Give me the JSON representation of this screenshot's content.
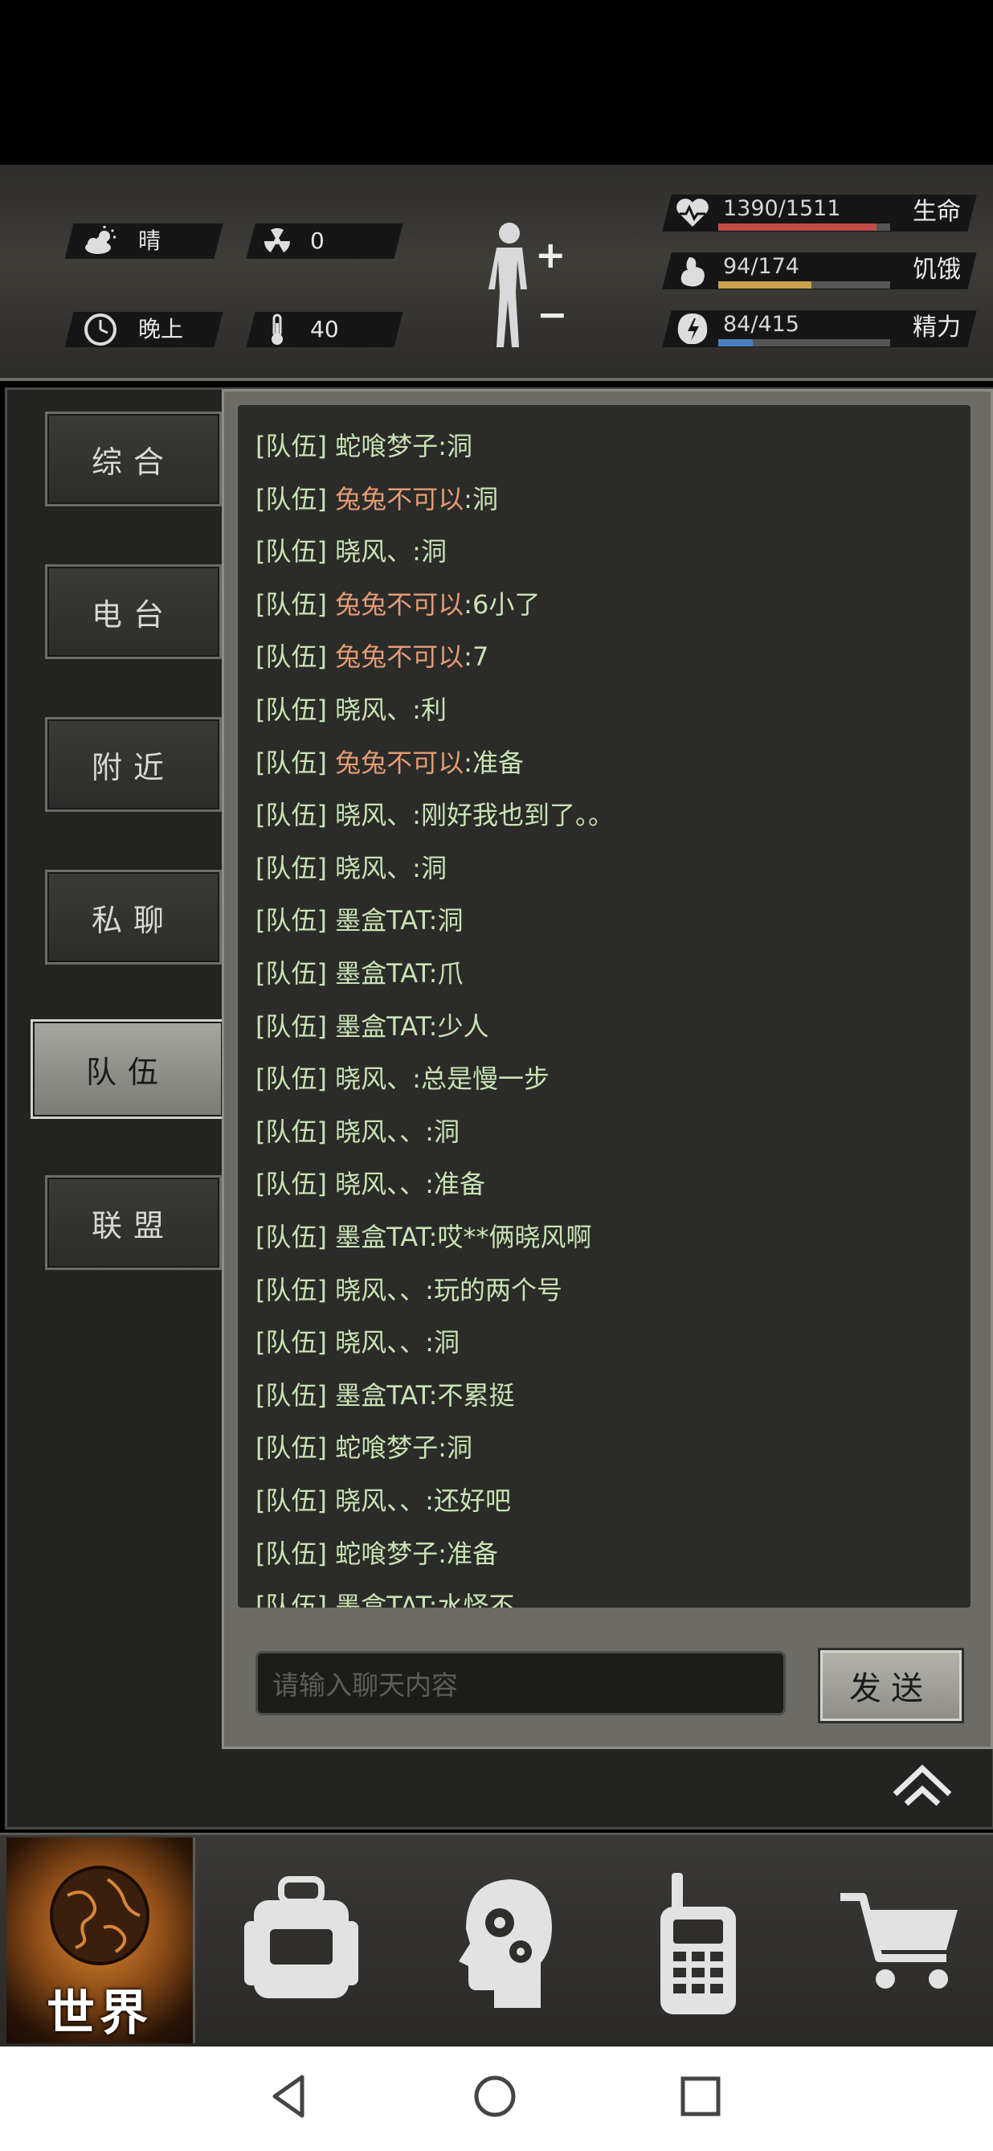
{
  "status": {
    "weather": "晴",
    "radiation": "0",
    "time_of_day": "晚上",
    "temperature": "40"
  },
  "vitals": [
    {
      "label": "生命",
      "value": "1390/1511",
      "current": 1390,
      "max": 1511,
      "color": "#c24d46"
    },
    {
      "label": "饥饿",
      "value": "94/174",
      "current": 94,
      "max": 174,
      "color": "#c9a24b"
    },
    {
      "label": "精力",
      "value": "84/415",
      "current": 84,
      "max": 415,
      "color": "#4a7fc0"
    }
  ],
  "tabs": [
    {
      "label": "综合"
    },
    {
      "label": "电台"
    },
    {
      "label": "附近"
    },
    {
      "label": "私聊"
    },
    {
      "label": "队伍"
    },
    {
      "label": "联盟"
    }
  ],
  "active_tab_index": 4,
  "messages": [
    {
      "channel": "[队伍]",
      "speaker": "蛇喰梦子",
      "text": ":洞",
      "highlight": false
    },
    {
      "channel": "[队伍]",
      "speaker": "兔兔不可以",
      "text": ":洞",
      "highlight": true
    },
    {
      "channel": "[队伍]",
      "speaker": "晓风、",
      "text": ":洞",
      "highlight": false
    },
    {
      "channel": "[队伍]",
      "speaker": "兔兔不可以",
      "text": ":6小了",
      "highlight": true
    },
    {
      "channel": "[队伍]",
      "speaker": "兔兔不可以",
      "text": ":7",
      "highlight": true
    },
    {
      "channel": "[队伍]",
      "speaker": "晓风、",
      "text": ":利",
      "highlight": false
    },
    {
      "channel": "[队伍]",
      "speaker": "兔兔不可以",
      "text": ":准备",
      "highlight": true
    },
    {
      "channel": "[队伍]",
      "speaker": "晓风、",
      "text": ":刚好我也到了。。",
      "highlight": false
    },
    {
      "channel": "[队伍]",
      "speaker": "晓风、",
      "text": ":洞",
      "highlight": false
    },
    {
      "channel": "[队伍]",
      "speaker": "墨盒TAT",
      "text": ":洞",
      "highlight": false
    },
    {
      "channel": "[队伍]",
      "speaker": "墨盒TAT",
      "text": ":爪",
      "highlight": false
    },
    {
      "channel": "[队伍]",
      "speaker": "墨盒TAT",
      "text": ":少人",
      "highlight": false
    },
    {
      "channel": "[队伍]",
      "speaker": "晓风、",
      "text": ":总是慢一步",
      "highlight": false
    },
    {
      "channel": "[队伍]",
      "speaker": "晓风、、",
      "text": ":洞",
      "highlight": false
    },
    {
      "channel": "[队伍]",
      "speaker": "晓风、、",
      "text": ":准备",
      "highlight": false
    },
    {
      "channel": "[队伍]",
      "speaker": "墨盒TAT",
      "text": ":哎**俩晓风啊",
      "highlight": false
    },
    {
      "channel": "[队伍]",
      "speaker": "晓风、、",
      "text": ":玩的两个号",
      "highlight": false
    },
    {
      "channel": "[队伍]",
      "speaker": "晓风、、",
      "text": ":洞",
      "highlight": false
    },
    {
      "channel": "[队伍]",
      "speaker": "墨盒TAT",
      "text": ":不累挺",
      "highlight": false
    },
    {
      "channel": "[队伍]",
      "speaker": "蛇喰梦子",
      "text": ":洞",
      "highlight": false
    },
    {
      "channel": "[队伍]",
      "speaker": "晓风、、",
      "text": ":还好吧",
      "highlight": false
    },
    {
      "channel": "[队伍]",
      "speaker": "蛇喰梦子",
      "text": ":准备",
      "highlight": false
    },
    {
      "channel": "[队伍]",
      "speaker": "墨盒TAT",
      "text": ":水怪不",
      "highlight": false
    }
  ],
  "chat_input": {
    "placeholder": "请输入聊天内容"
  },
  "send_label": "发送",
  "bottom_nav": {
    "world_label": "世界",
    "items": [
      "backpack-icon",
      "brain-gears-icon",
      "walkie-talkie-icon",
      "cart-icon"
    ]
  }
}
